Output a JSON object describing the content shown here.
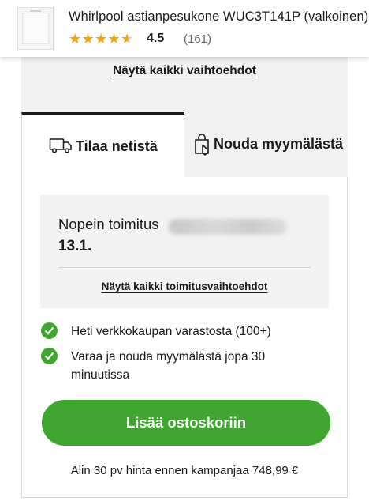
{
  "header": {
    "product_title": "Whirlpool astianpesukone WUC3T141P (valkoinen)",
    "rating": 4.5,
    "rating_text": "4.5",
    "review_count": "(161)",
    "star_color": "#f0a60d",
    "thumbnail_icon": "dishwasher-thumbnail"
  },
  "options_link": "Näytä kaikki vaihtoehdot",
  "tabs": [
    {
      "label": "Tilaa netistä",
      "icon": "truck-icon",
      "active": true
    },
    {
      "label": "Nouda myymälästä",
      "icon": "store-pickup-icon",
      "active": false
    }
  ],
  "delivery": {
    "fastest_label": "Nopein toimitus",
    "date": "13.1.",
    "all_delivery_link": "Näytä kaikki toimitusvaihtoehdot"
  },
  "features": [
    {
      "text": "Heti verkkokaupan varastosta (100+)",
      "icon": "check-circle-icon"
    },
    {
      "text": "Varaa ja nouda myymälästä jopa 30 minuutissa",
      "icon": "check-circle-icon"
    }
  ],
  "cart_button": {
    "label": "Lisää ostoskoriin",
    "color": "#3ea62f"
  },
  "price_note": "Alin 30 pv hinta ennen kampanjaa 748,99 €"
}
